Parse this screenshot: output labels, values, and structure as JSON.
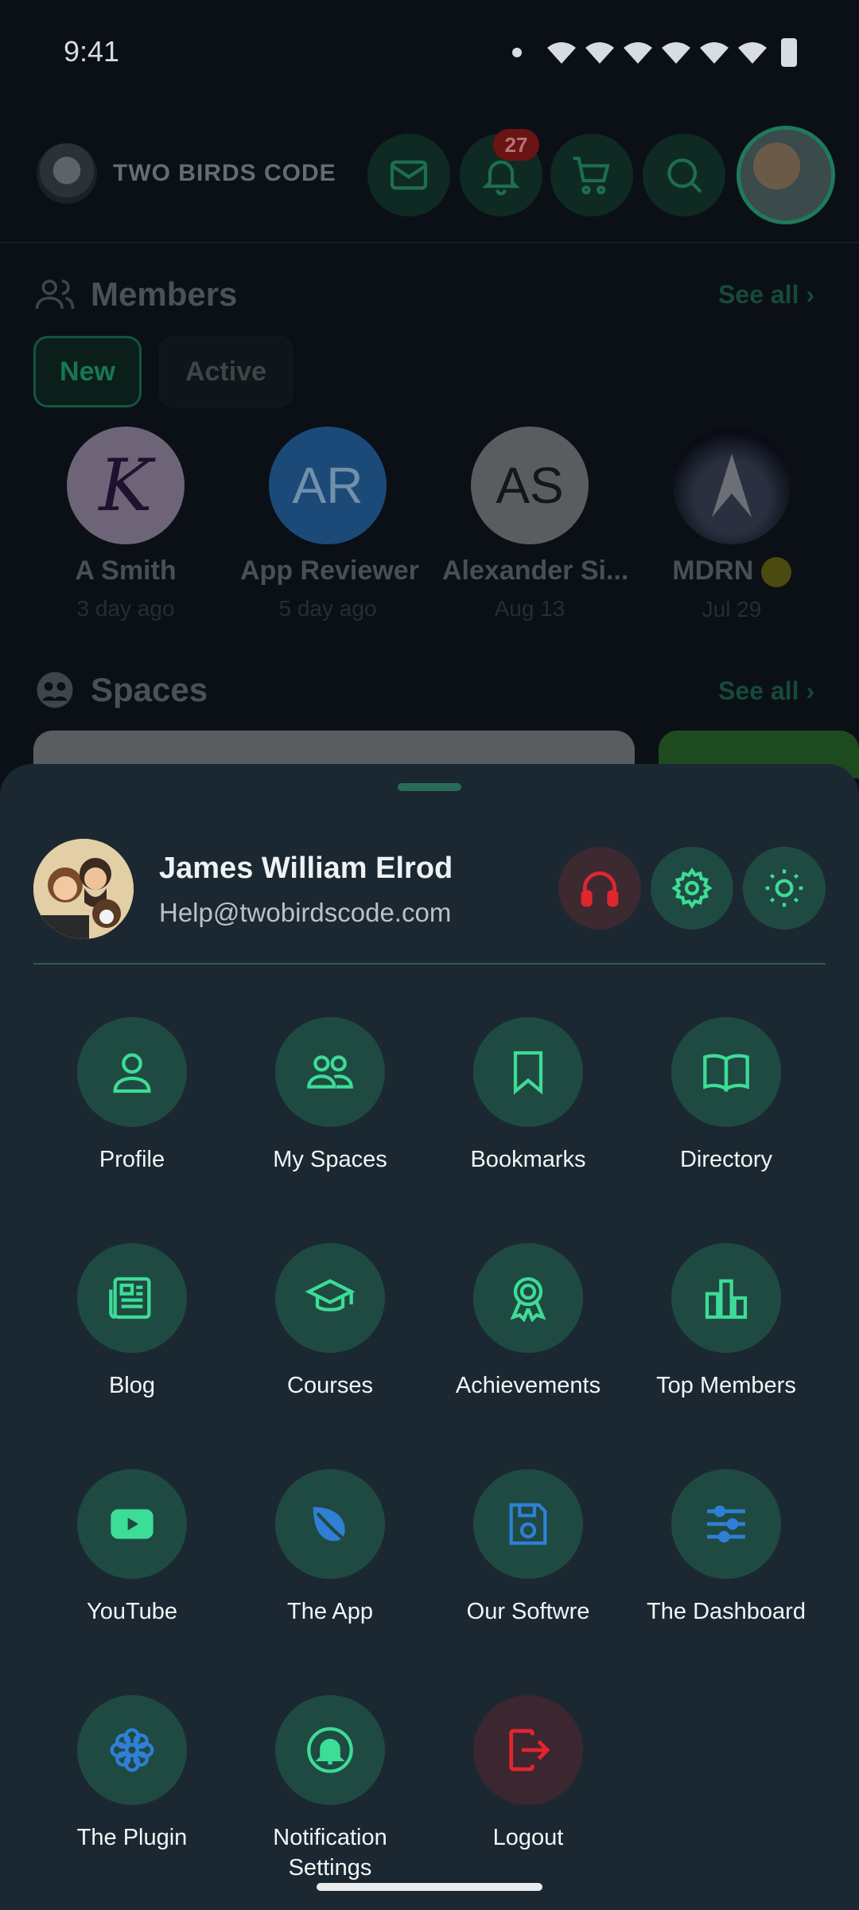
{
  "status_bar": {
    "time": "9:41"
  },
  "header": {
    "brand_name": "TWO BIRDS CODE",
    "notification_count": "27"
  },
  "members": {
    "title": "Members",
    "see_all": "See all",
    "tabs": [
      "New",
      "Active"
    ],
    "list": [
      {
        "name": "A Smith",
        "when": "3 day ago",
        "initials": "K"
      },
      {
        "name": "App Reviewer",
        "when": "5 day ago",
        "initials": "AR"
      },
      {
        "name": "Alexander Si...",
        "when": "Aug 13",
        "initials": "AS"
      },
      {
        "name": "MDRN",
        "when": "Jul 29",
        "initials": ""
      }
    ]
  },
  "spaces": {
    "title": "Spaces",
    "see_all": "See all"
  },
  "profile": {
    "name": "James William Elrod",
    "email": "Help@twobirdscode.com"
  },
  "menu": [
    {
      "label": "Profile",
      "icon": "user-icon"
    },
    {
      "label": "My Spaces",
      "icon": "users-icon"
    },
    {
      "label": "Bookmarks",
      "icon": "bookmark-icon"
    },
    {
      "label": "Directory",
      "icon": "book-open-icon"
    },
    {
      "label": "Blog",
      "icon": "newspaper-icon"
    },
    {
      "label": "Courses",
      "icon": "graduation-cap-icon"
    },
    {
      "label": "Achievements",
      "icon": "award-icon"
    },
    {
      "label": "Top Members",
      "icon": "bar-chart-icon"
    },
    {
      "label": "YouTube",
      "icon": "youtube-icon"
    },
    {
      "label": "The App",
      "icon": "leaf-icon"
    },
    {
      "label": "Our Softwre",
      "icon": "floppy-disk-icon"
    },
    {
      "label": "The Dashboard",
      "icon": "sliders-icon"
    },
    {
      "label": "The Plugin",
      "icon": "flower-icon"
    },
    {
      "label": "Notification Settings",
      "icon": "bell-icon"
    },
    {
      "label": "Logout",
      "icon": "logout-icon"
    }
  ],
  "colors": {
    "accent": "#3ddc97",
    "sheet_bg": "#1b2831",
    "icon_circle": "#1f4a42",
    "danger": "#e0262e",
    "blue_icon": "#2f7fd6"
  }
}
